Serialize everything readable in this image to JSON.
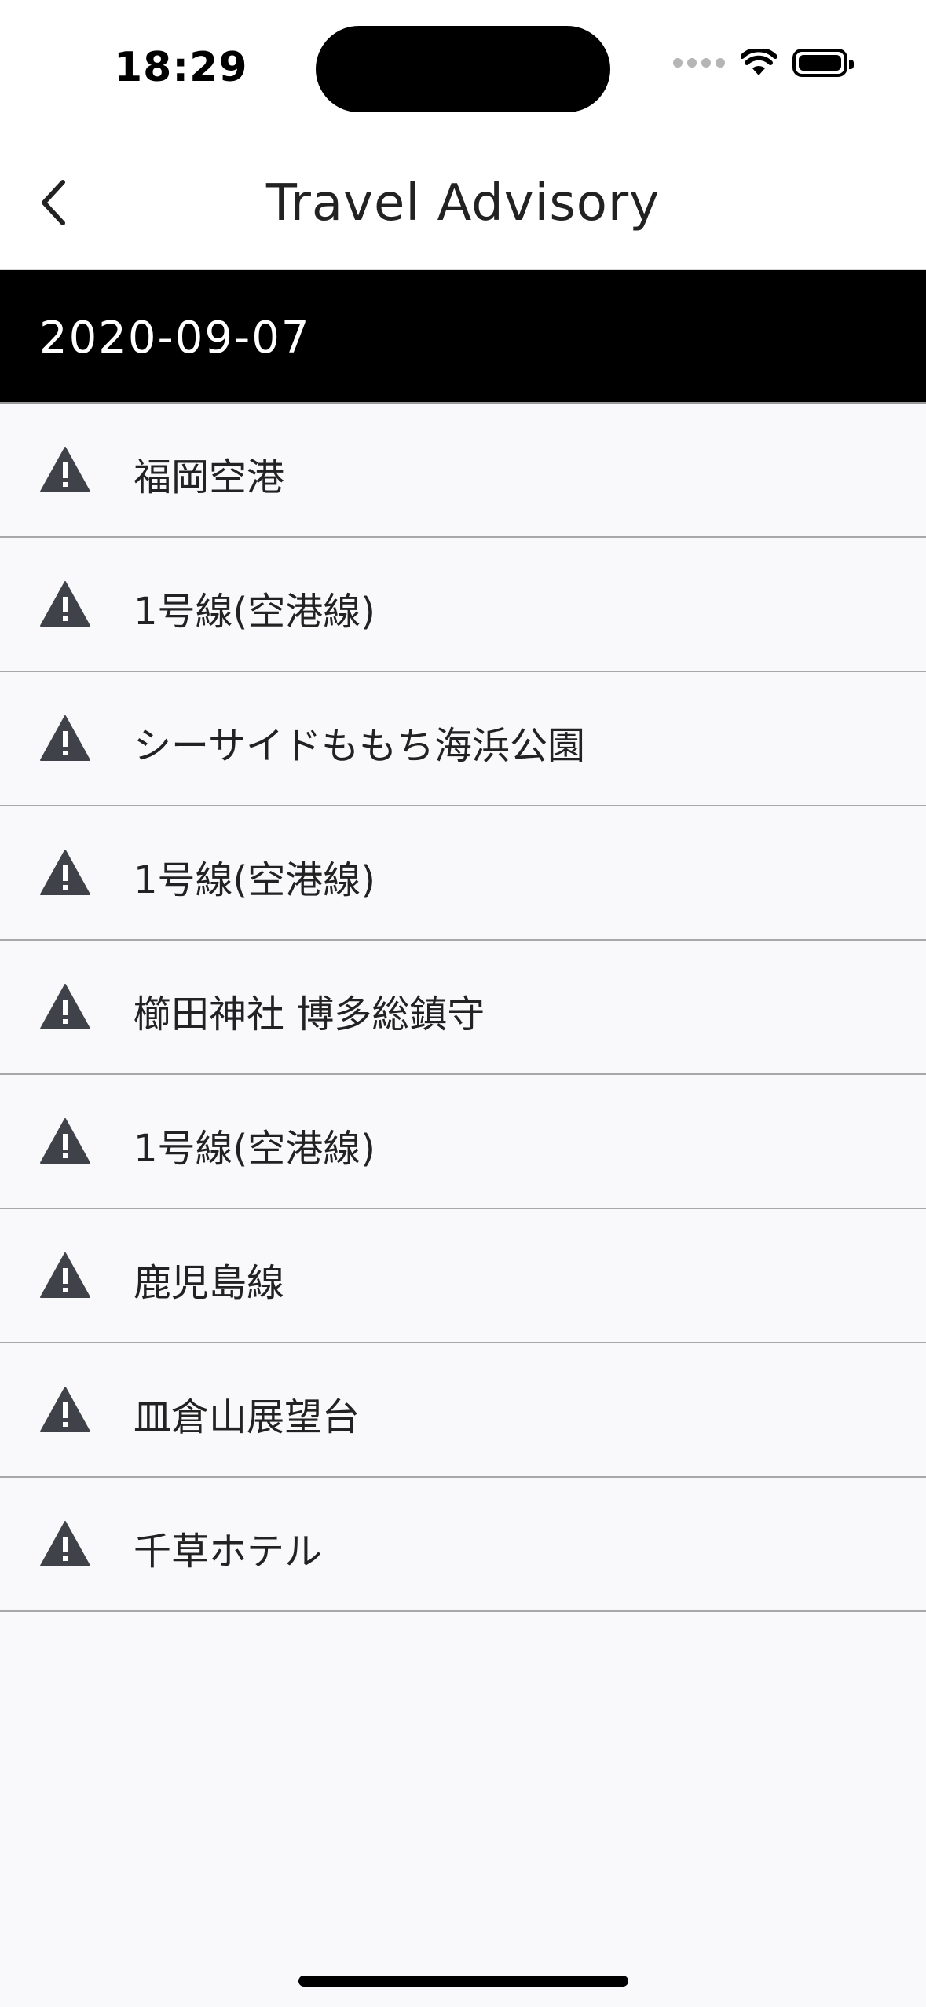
{
  "status_bar": {
    "time": "18:29"
  },
  "nav": {
    "title": "Travel Advisory",
    "back_icon": "chevron-left-icon"
  },
  "section": {
    "date": "2020-09-07"
  },
  "advisories": [
    {
      "label": "福岡空港",
      "icon": "warning-icon"
    },
    {
      "label": "1号線(空港線)",
      "icon": "warning-icon"
    },
    {
      "label": "シーサイドももち海浜公園",
      "icon": "warning-icon"
    },
    {
      "label": "1号線(空港線)",
      "icon": "warning-icon"
    },
    {
      "label": "櫛田神社 博多総鎮守",
      "icon": "warning-icon"
    },
    {
      "label": "1号線(空港線)",
      "icon": "warning-icon"
    },
    {
      "label": "鹿児島線",
      "icon": "warning-icon"
    },
    {
      "label": "皿倉山展望台",
      "icon": "warning-icon"
    },
    {
      "label": "千草ホテル",
      "icon": "warning-icon"
    }
  ],
  "colors": {
    "header_bg": "#000000",
    "list_bg": "#f9f9fb",
    "icon": "#3f4248"
  }
}
